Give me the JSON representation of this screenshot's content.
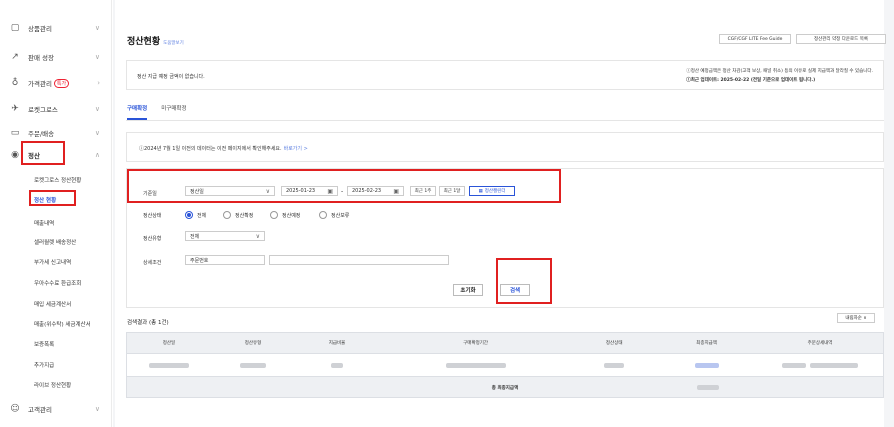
{
  "sidebar": {
    "items": [
      {
        "label": "상품관리",
        "icon": "shopping-bag-icon"
      },
      {
        "label": "판매 성장",
        "icon": "trend-up-icon"
      },
      {
        "label": "가격관리",
        "badge": "특가",
        "icon": "award-icon"
      },
      {
        "label": "로켓그로스",
        "icon": "rocket-icon"
      },
      {
        "label": "주문/배송",
        "icon": "truck-icon"
      },
      {
        "label": "정산",
        "icon": "coin-icon"
      },
      {
        "label": "고객관리",
        "icon": "smile-icon"
      }
    ],
    "sub_items": [
      "로켓그로스 정산현황",
      "정산 현황",
      "매출내역",
      "셀러월렛 배송정산",
      "부가세 신고내역",
      "우아수수료 환급조회",
      "매입 세금계산서",
      "매출(위수탁) 세금계산서",
      "보증폭록",
      "추가지급",
      "라이브 정산현황"
    ]
  },
  "header": {
    "title": "정산현황",
    "title_sub": "도움말보기",
    "btn_guide": "CGF/CGF LITE Fee Guide",
    "btn_download": "정산관리 약정 다운로드 목록"
  },
  "notice": {
    "left": "정산 지급 예정 금액이 없습니다.",
    "right_1": "ⓘ정산 예정금액은 정산 차감(고객 보상, 패널 취소) 등의 이유로 실제 지급액과 달라질 수 있습니다.",
    "right_2": "ⓘ최근 업데이트: 2025-02-22 (전일 기준으로 업데이트 됩니다.)"
  },
  "tabs": [
    "구매확정",
    "미구매확정"
  ],
  "info": {
    "text": "ⓘ2024년 7월 1일 이전의 데이터는 이전 페이지에서 확인해주세요.",
    "link": "바로가기 >"
  },
  "form": {
    "period_label": "기준일",
    "period_select": "정산일",
    "date_from": "2025-01-23",
    "date_to": "2025-02-23",
    "quick_1w": "최근 1주",
    "quick_1m": "최근 1달",
    "calendar_btn": "정산캘린더",
    "status_label": "정산상태",
    "status_options": [
      "전체",
      "정산확정",
      "정산예정",
      "정산보류"
    ],
    "type_label": "정산유형",
    "type_select": "전체",
    "detail_label": "상세조건",
    "detail_select": "주문번호",
    "detail_input": "",
    "reset_btn": "초기화",
    "search_btn": "검색"
  },
  "result": {
    "title": "검색결과 (총 1건)",
    "sort": "내림차순 ∨",
    "columns": [
      "정산일",
      "정산유형",
      "지급비율",
      "구매확정기간",
      "정산상태",
      "최종지급액",
      "주문상세내역"
    ],
    "total_label": "총 최종지급액"
  },
  "colors": {
    "accent": "#2a54d8",
    "highlight": "#e02020"
  }
}
